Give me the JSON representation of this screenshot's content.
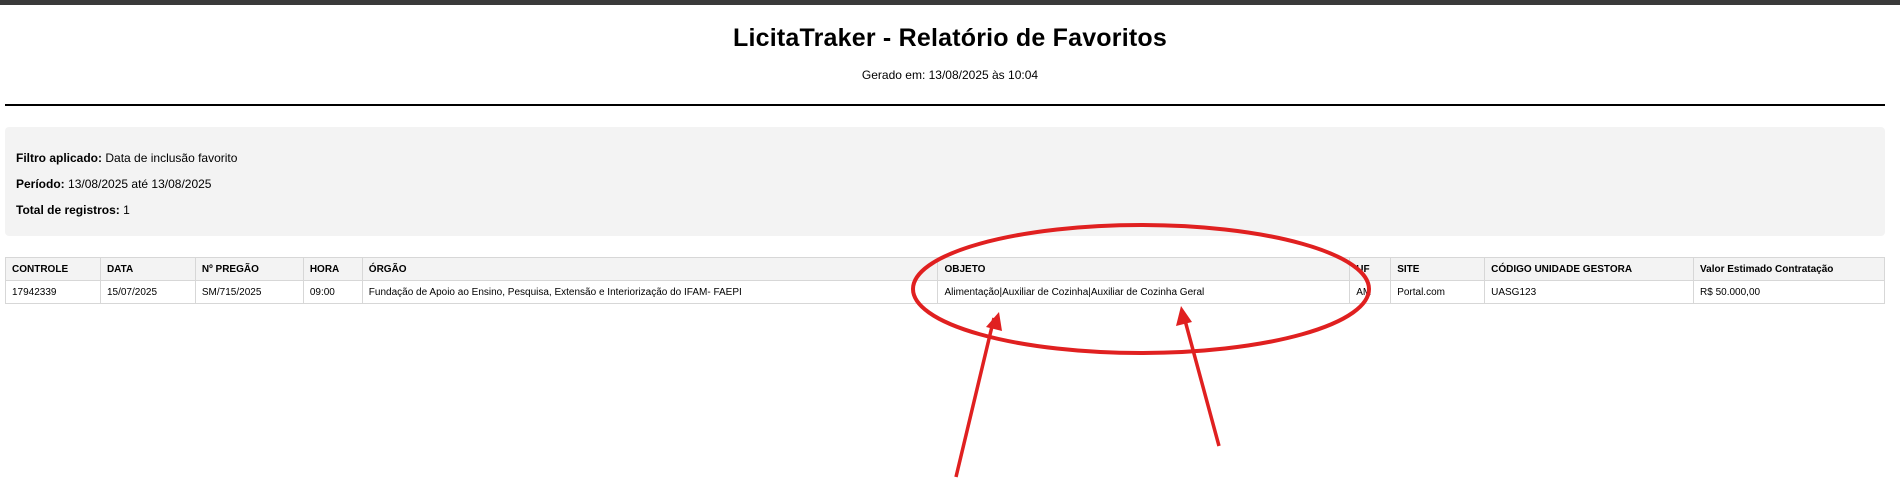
{
  "report": {
    "title": "LicitaTraker - Relatório de Favoritos",
    "generated": "Gerado em: 13/08/2025 às 10:04"
  },
  "filters": {
    "filter_label": "Filtro aplicado:",
    "filter_value": "Data de inclusão favorito",
    "period_label": "Período:",
    "period_value": "13/08/2025 até 13/08/2025",
    "total_label": "Total de registros:",
    "total_value": "1"
  },
  "table": {
    "headers": [
      "CONTROLE",
      "DATA",
      "Nº PREGÃO",
      "HORA",
      "ÓRGÃO",
      "OBJETO",
      "UF",
      "SITE",
      "CÓDIGO UNIDADE GESTORA",
      "Valor Estimado Contratação"
    ],
    "rows": [
      [
        "17942339",
        "15/07/2025",
        "SM/715/2025",
        "09:00",
        "Fundação de Apoio ao Ensino, Pesquisa, Extensão e Interiorização do IFAM- FAEPI",
        "Alimentação|Auxiliar de Cozinha|Auxiliar de Cozinha Geral",
        "AM",
        "Portal.com",
        "UASG123",
        "R$ 50.000,00"
      ]
    ]
  },
  "annotation": {
    "color": "#e02020"
  }
}
